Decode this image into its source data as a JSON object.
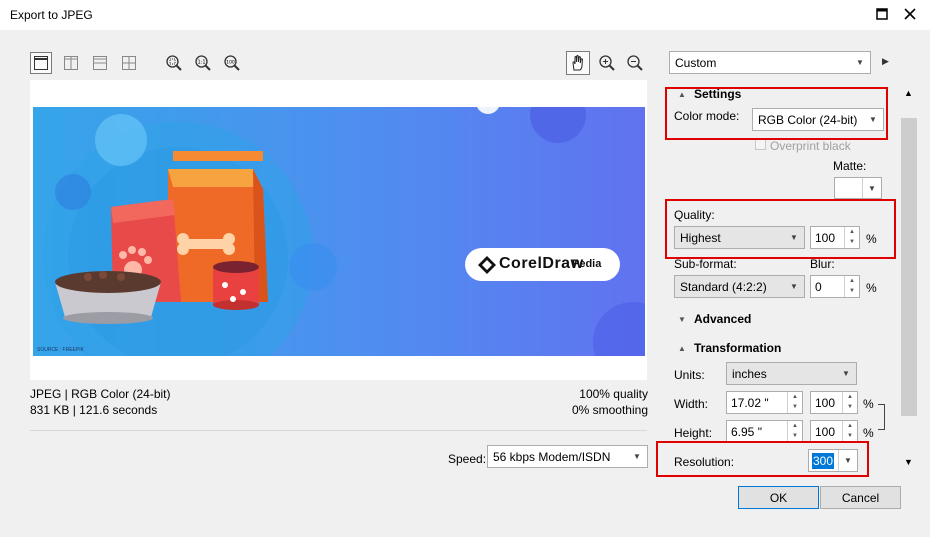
{
  "window": {
    "title": "Export to JPEG"
  },
  "preview": {
    "logo_text": "CorelDraw",
    "logo_suffix": "Pedia",
    "source_credit": "SOURCE : FREEPIK",
    "format_line": "JPEG  |  RGB Color (24-bit)",
    "size_line": "831 KB  |  121.6 seconds",
    "quality_line": "100% quality",
    "smoothing_line": "0% smoothing",
    "speed_label": "Speed:",
    "speed_value": "56 kbps Modem/ISDN"
  },
  "preset": {
    "value": "Custom"
  },
  "settings": {
    "section_label": "Settings",
    "color_mode_label": "Color mode:",
    "color_mode_value": "RGB Color (24-bit)",
    "overprint_label": "Overprint black",
    "matte_label": "Matte:",
    "quality_label": "Quality:",
    "quality_value": "Highest",
    "quality_percent": "100",
    "percent_sign": "%",
    "subformat_label": "Sub-format:",
    "subformat_value": "Standard (4:2:2)",
    "blur_label": "Blur:",
    "blur_value": "0"
  },
  "advanced": {
    "section_label": "Advanced"
  },
  "transformation": {
    "section_label": "Transformation",
    "units_label": "Units:",
    "units_value": "inches",
    "width_label": "Width:",
    "width_value": "17.02 \"",
    "width_percent": "100",
    "height_label": "Height:",
    "height_value": "6.95 \"",
    "height_percent": "100",
    "resolution_label": "Resolution:",
    "resolution_value": "300"
  },
  "buttons": {
    "ok": "OK",
    "cancel": "Cancel"
  },
  "colors": {
    "highlight_red": "#e00000",
    "selection_blue": "#0078d7"
  }
}
